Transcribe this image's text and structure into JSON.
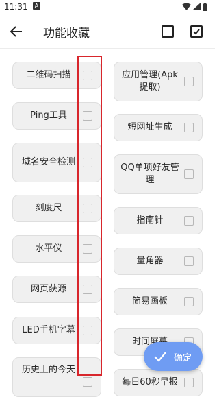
{
  "status": {
    "time": "11:31",
    "notification_icon": "A"
  },
  "appbar": {
    "title": "功能收藏"
  },
  "left_items": [
    {
      "label": "二维码扫描"
    },
    {
      "label": "Ping工具"
    },
    {
      "label": "域名安全检测"
    },
    {
      "label": "刻度尺"
    },
    {
      "label": "水平仪"
    },
    {
      "label": "网页获源"
    },
    {
      "label": "LED手机字幕"
    },
    {
      "label": "历史上的今天"
    }
  ],
  "right_items": [
    {
      "label": "应用管理(Apk提取)"
    },
    {
      "label": "短网址生成"
    },
    {
      "label": "QQ单项好友管理"
    },
    {
      "label": "指南针"
    },
    {
      "label": "量角器"
    },
    {
      "label": "简易画板"
    },
    {
      "label": "时间屏幕"
    },
    {
      "label": "每日60秒早报"
    }
  ],
  "fab": {
    "label": "确定",
    "color": "#6f9cf3"
  },
  "colors": {
    "highlight_border": "#d8262c",
    "card_bg": "#f0f0f0"
  }
}
